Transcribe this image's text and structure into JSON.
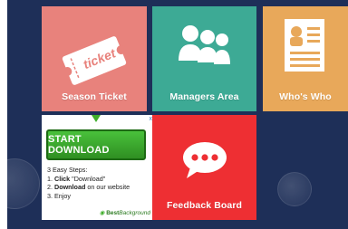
{
  "tiles": [
    {
      "id": "season-ticket",
      "label": "Season Ticket",
      "color": "#e8827c",
      "icon": "ticket-icon",
      "icon_text": "ticket"
    },
    {
      "id": "managers-area",
      "label": "Managers Area",
      "color": "#3daa95",
      "icon": "people-icon"
    },
    {
      "id": "whos-who",
      "label": "Who's Who",
      "color": "#e8a85a",
      "icon": "profile-document-icon"
    },
    {
      "id": "feedback-board",
      "label": "Feedback Board",
      "color": "#ee2f33",
      "icon": "chat-bubble-icon"
    }
  ],
  "ad": {
    "close_label": "x",
    "button_label": "START DOWNLOAD",
    "steps_title": "3 Easy Steps:",
    "steps": [
      {
        "num": "1.",
        "bold": "Click",
        "rest": " \"Download\""
      },
      {
        "num": "2.",
        "bold": "Download",
        "rest": " on our website"
      },
      {
        "num": "3.",
        "bold": "",
        "rest": "Enjoy"
      }
    ],
    "brand_prefix": "Best",
    "brand_name": "Background"
  },
  "colors": {
    "background": "#1e2f58",
    "ad_button": "#3fae2a"
  }
}
